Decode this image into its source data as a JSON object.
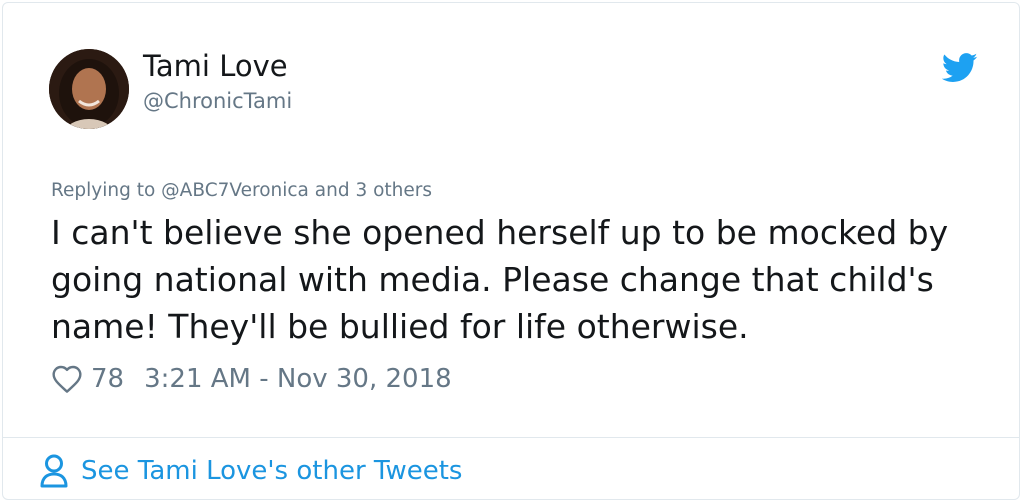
{
  "tweet": {
    "author_name": "Tami Love",
    "author_handle": "@ChronicTami",
    "reply_prefix": "Replying to @ABC7Veronica and 3 others",
    "text": "I can't believe she opened herself up to be mocked by going national with media. Please change that child's name! They'll be bullied for life otherwise.",
    "likes": "78",
    "timestamp": "3:21 AM - Nov 30, 2018"
  },
  "footer": {
    "see_more_label": "See Tami Love's other Tweets"
  },
  "colors": {
    "twitter_blue": "#1da1f2",
    "link_blue": "#1b95e0",
    "muted_text": "#657786",
    "primary_text": "#14171a",
    "border": "#e1e8ed"
  },
  "icons": {
    "brand": "twitter-bird-icon",
    "like": "heart-outline-icon",
    "profile": "person-outline-icon"
  }
}
